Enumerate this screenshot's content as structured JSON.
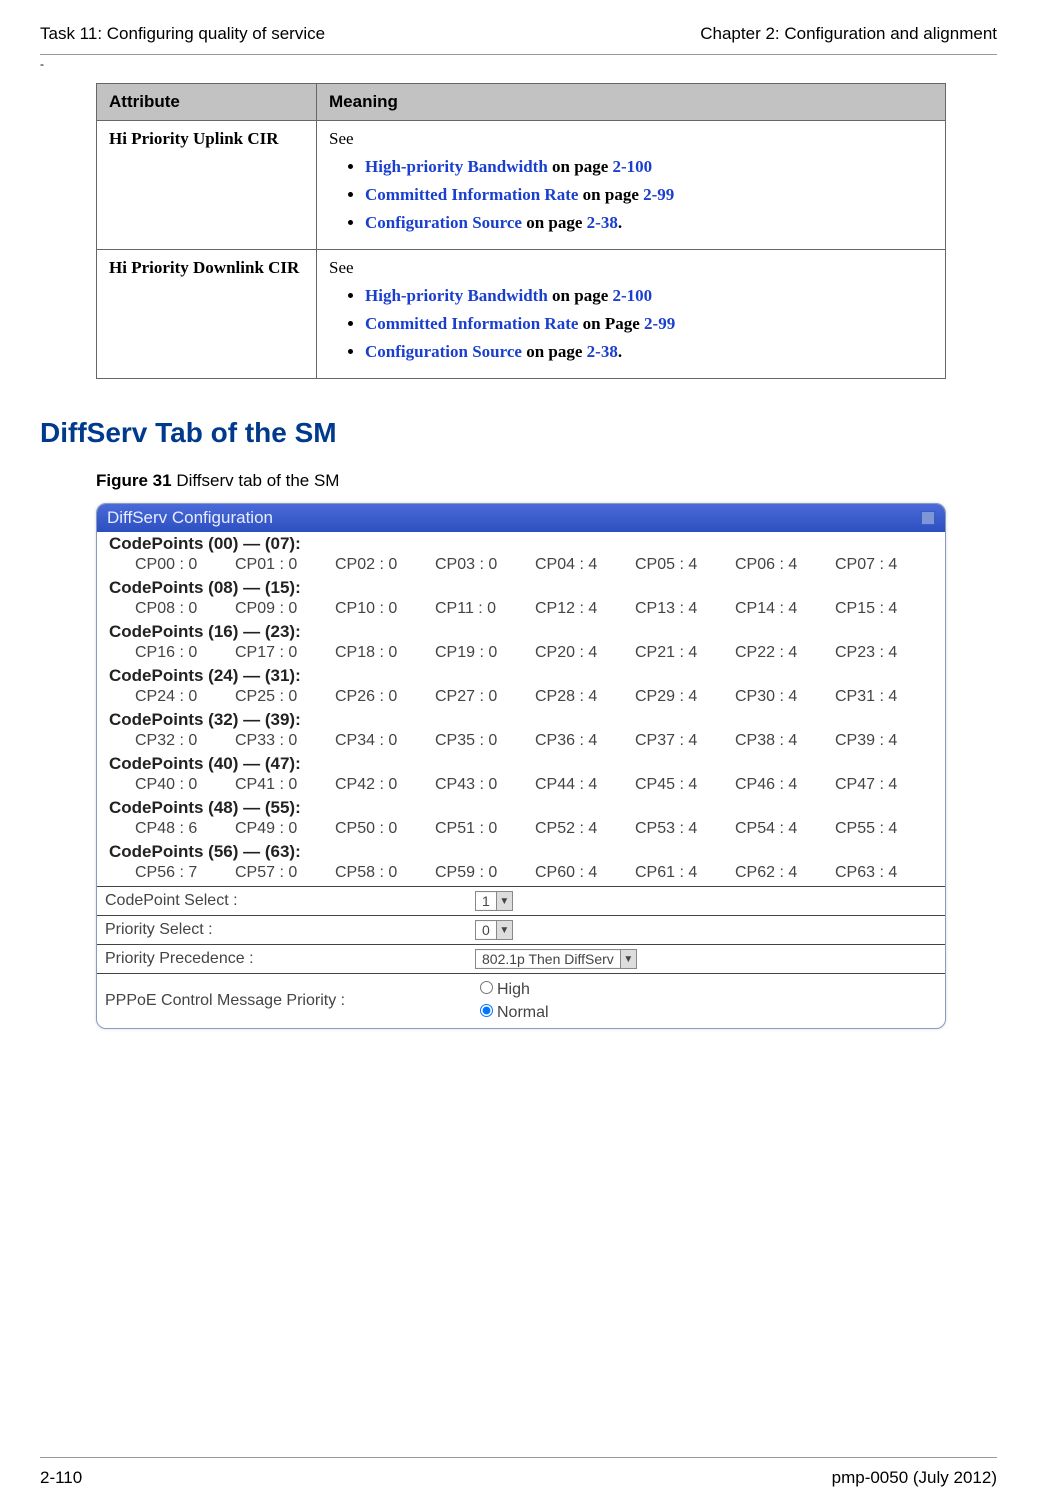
{
  "header": {
    "left": "Task 11: Configuring quality of service",
    "right": "Chapter 2:  Configuration and alignment"
  },
  "table": {
    "th_attr": "Attribute",
    "th_meaning": "Meaning",
    "rows": [
      {
        "attr": "Hi Priority Uplink CIR",
        "see": "See",
        "items": [
          {
            "xref": "High-priority Bandwidth",
            "on": " on page ",
            "p": "2-100"
          },
          {
            "xref": "Committed Information Rate",
            "on": " on page ",
            "p": "2-99"
          },
          {
            "xref": "Configuration Source",
            "on": " on page ",
            "p": "2-38",
            "tail": "."
          }
        ]
      },
      {
        "attr": "Hi Priority Downlink CIR",
        "see": "See",
        "items": [
          {
            "xref": "High-priority Bandwidth",
            "on": " on page ",
            "p": "2-100"
          },
          {
            "xref": "Committed Information Rate",
            "on": " on Page ",
            "p": "2-99"
          },
          {
            "xref": "Configuration Source",
            "on": " on page ",
            "p": "2-38",
            "tail": "."
          }
        ]
      }
    ]
  },
  "section_title": "DiffServ Tab of the SM",
  "figure": {
    "label": "Figure 31",
    "caption": "  Diffserv tab of the SM"
  },
  "panel": {
    "title": "DiffServ Configuration",
    "groups": [
      {
        "head": "CodePoints (00) — (07):",
        "cells": [
          "CP00 : 0",
          "CP01 : 0",
          "CP02 : 0",
          "CP03 : 0",
          "CP04 : 4",
          "CP05 : 4",
          "CP06 : 4",
          "CP07 : 4"
        ]
      },
      {
        "head": "CodePoints (08) — (15):",
        "cells": [
          "CP08 : 0",
          "CP09 : 0",
          "CP10 : 0",
          "CP11 : 0",
          "CP12 : 4",
          "CP13 : 4",
          "CP14 : 4",
          "CP15 : 4"
        ]
      },
      {
        "head": "CodePoints (16) — (23):",
        "cells": [
          "CP16 : 0",
          "CP17 : 0",
          "CP18 : 0",
          "CP19 : 0",
          "CP20 : 4",
          "CP21 : 4",
          "CP22 : 4",
          "CP23 : 4"
        ]
      },
      {
        "head": "CodePoints (24) — (31):",
        "cells": [
          "CP24 : 0",
          "CP25 : 0",
          "CP26 : 0",
          "CP27 : 0",
          "CP28 : 4",
          "CP29 : 4",
          "CP30 : 4",
          "CP31 : 4"
        ]
      },
      {
        "head": "CodePoints (32) — (39):",
        "cells": [
          "CP32 : 0",
          "CP33 : 0",
          "CP34 : 0",
          "CP35 : 0",
          "CP36 : 4",
          "CP37 : 4",
          "CP38 : 4",
          "CP39 : 4"
        ]
      },
      {
        "head": "CodePoints (40) — (47):",
        "cells": [
          "CP40 : 0",
          "CP41 : 0",
          "CP42 : 0",
          "CP43 : 0",
          "CP44 : 4",
          "CP45 : 4",
          "CP46 : 4",
          "CP47 : 4"
        ]
      },
      {
        "head": "CodePoints (48) — (55):",
        "cells": [
          "CP48 : 6",
          "CP49 : 0",
          "CP50 : 0",
          "CP51 : 0",
          "CP52 : 4",
          "CP53 : 4",
          "CP54 : 4",
          "CP55 : 4"
        ]
      },
      {
        "head": "CodePoints (56) — (63):",
        "cells": [
          "CP56 : 7",
          "CP57 : 0",
          "CP58 : 0",
          "CP59 : 0",
          "CP60 : 4",
          "CP61 : 4",
          "CP62 : 4",
          "CP63 : 4"
        ]
      }
    ],
    "form": {
      "codepoint_select": {
        "label": "CodePoint Select :",
        "value": "1"
      },
      "priority_select": {
        "label": "Priority Select :",
        "value": "0"
      },
      "priority_prec": {
        "label": "Priority Precedence :",
        "value": "802.1p Then DiffServ"
      },
      "pppoe": {
        "label": "PPPoE Control Message Priority :",
        "opt_high": "High",
        "opt_normal": "Normal",
        "selected": "Normal"
      }
    }
  },
  "footer": {
    "left": "2-110",
    "right": "pmp-0050 (July 2012)"
  }
}
